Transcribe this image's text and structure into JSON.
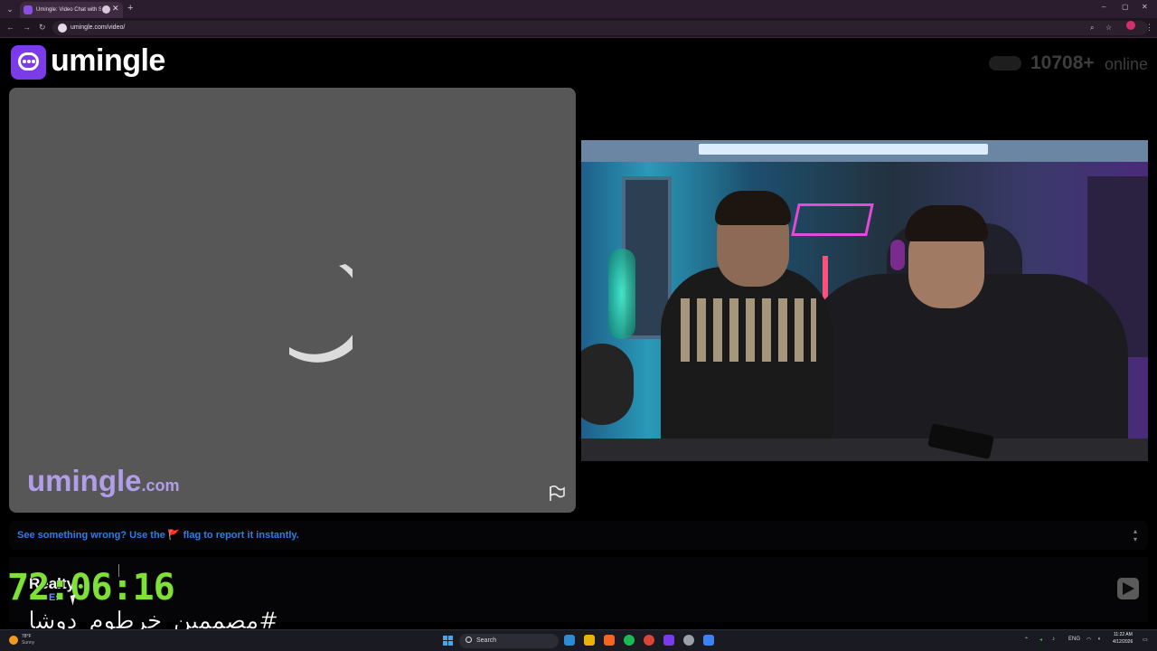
{
  "browser": {
    "tab_title": "Umingle: Video Chat with S",
    "url": "umingle.com/video/",
    "menu_icon": "chevron-down-icon",
    "new_tab_label": "+",
    "close_tab_label": "✕",
    "window_controls": [
      "–",
      "▢",
      "✕"
    ]
  },
  "header": {
    "brand": "umingle",
    "online_count": "10708+",
    "online_label": "online"
  },
  "left_panel": {
    "watermark_main": "umingle",
    "watermark_suffix": ".com",
    "report_icon": "flag-icon"
  },
  "report_bar": {
    "text_before": "See something wrong? Use the",
    "flag_glyph": "🚩",
    "text_after": "flag to report it instantly."
  },
  "chat": {
    "send_icon": "send-arrow-icon"
  },
  "overlay": {
    "name": "Realty",
    "sub": "Es",
    "timer": "72:06:16",
    "hashtag": "#مصممين_خرطوم_دوشا"
  },
  "taskbar": {
    "weather_temp": "78°F",
    "weather_cond": "Sunny",
    "search_label": "Search",
    "language": "ENG",
    "clock_time": "11:22 AM",
    "clock_date": "4/12/2026",
    "app_colors": [
      "#2e8bd6",
      "#1db954",
      "#f26522",
      "#eab308",
      "#7c3aed",
      "#e0e0e0",
      "#3b82f6"
    ]
  },
  "colors": {
    "brand_purple": "#7c3be8",
    "watermark_purple": "#b19ee8",
    "report_link_blue": "#2f7de8",
    "timer_green": "#7fe03a"
  }
}
